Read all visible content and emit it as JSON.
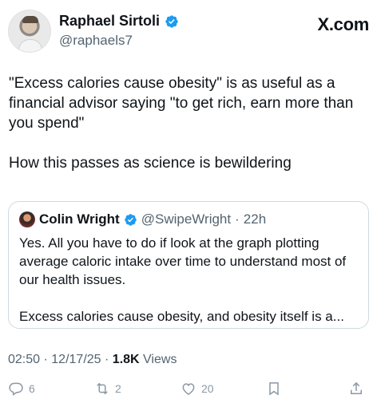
{
  "author": {
    "name": "Raphael Sirtoli",
    "handle": "@raphaels7",
    "verified": true
  },
  "brand": "X.com",
  "tweet": {
    "text": "\"Excess calories cause obesity\" is as useful as a financial advisor saying \"to get rich, earn more than you spend\"\n\nHow this passes as science is bewildering"
  },
  "quote": {
    "name": "Colin Wright",
    "handle": "@SwipeWright",
    "separator": "·",
    "time": "22h",
    "text": "Yes. All you have to do if look at the graph plotting average caloric intake over time to understand most of our health issues.\n\nExcess calories cause obesity, and obesity itself is a..."
  },
  "meta": {
    "time": "02:50",
    "sep1": "·",
    "date": "12/17/25",
    "sep2": "·",
    "views_count": "1.8K",
    "views_label": "Views"
  },
  "actions": {
    "replies": "6",
    "reposts": "2",
    "likes": "20"
  },
  "colors": {
    "verified": "#1d9bf0",
    "muted": "#536471",
    "border": "#cfd9de"
  }
}
